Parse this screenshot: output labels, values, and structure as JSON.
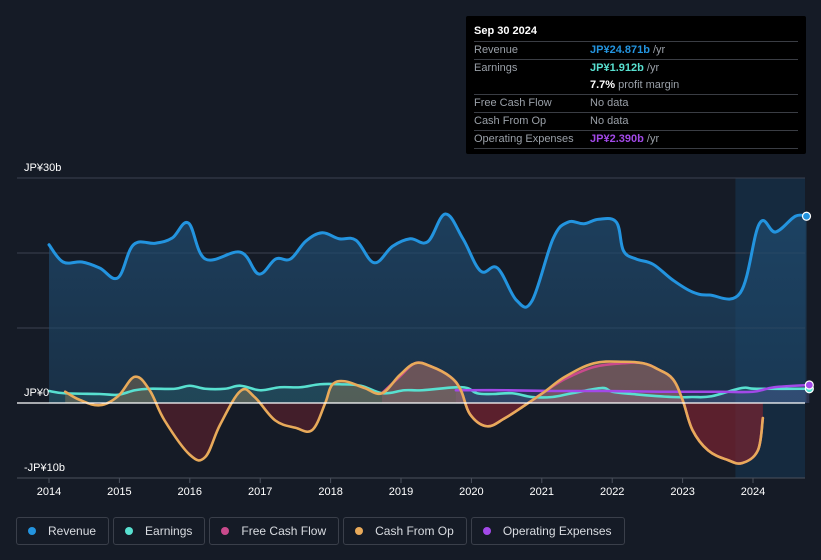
{
  "colors": {
    "background": "#151b26",
    "revenue": "#2394df",
    "earnings": "#58e0d0",
    "free_cash_flow": "#c94a8c",
    "cash_from_op": "#e8aa5a",
    "operating_expenses": "#a249e8",
    "grid": "#3a4150",
    "zero_line": "#ffffff",
    "negative_fill": "#5a1f26",
    "highlight_band": "#1a3550"
  },
  "tooltip": {
    "date": "Sep 30 2024",
    "rows": [
      {
        "label": "Revenue",
        "value": "JP¥24.871b",
        "suffix": " /yr",
        "color": "#2394df"
      },
      {
        "label": "Earnings",
        "value": "JP¥1.912b",
        "suffix": " /yr",
        "color": "#58e0d0"
      },
      {
        "label": "",
        "value": "7.7%",
        "suffix": " profit margin",
        "color": "#ffffff"
      },
      {
        "label": "Free Cash Flow",
        "value": "",
        "suffix": "No data",
        "color": "#9aa0a8"
      },
      {
        "label": "Cash From Op",
        "value": "",
        "suffix": "No data",
        "color": "#9aa0a8"
      },
      {
        "label": "Operating Expenses",
        "value": "JP¥2.390b",
        "suffix": " /yr",
        "color": "#a249e8"
      }
    ]
  },
  "legend": [
    {
      "label": "Revenue",
      "key": "revenue"
    },
    {
      "label": "Earnings",
      "key": "earnings"
    },
    {
      "label": "Free Cash Flow",
      "key": "free_cash_flow"
    },
    {
      "label": "Cash From Op",
      "key": "cash_from_op"
    },
    {
      "label": "Operating Expenses",
      "key": "operating_expenses"
    }
  ],
  "chart_data": {
    "type": "area",
    "title": "",
    "xlabel": "",
    "ylabel": "",
    "y_tick_labels": [
      {
        "value": 30,
        "label": "JP¥30b"
      },
      {
        "value": 0,
        "label": "JP¥0"
      },
      {
        "value": -10,
        "label": "-JP¥10b"
      }
    ],
    "x_tick_labels": [
      "2014",
      "2015",
      "2016",
      "2017",
      "2018",
      "2019",
      "2020",
      "2021",
      "2022",
      "2023",
      "2024"
    ],
    "xlim": [
      2013.55,
      2024.8
    ],
    "ylim": [
      -10,
      30
    ],
    "grid": true,
    "highlight_from": 2023.75,
    "legend_position": "bottom-left",
    "units": "JPY billions",
    "series": [
      {
        "name": "Revenue",
        "key": "revenue",
        "x": [
          2014.0,
          2014.2,
          2014.47,
          2014.72,
          2014.98,
          2015.2,
          2015.51,
          2015.75,
          2015.98,
          2016.22,
          2016.72,
          2016.98,
          2017.22,
          2017.43,
          2017.65,
          2017.88,
          2018.12,
          2018.36,
          2018.62,
          2018.88,
          2019.13,
          2019.38,
          2019.63,
          2019.88,
          2020.13,
          2020.37,
          2020.64,
          2020.86,
          2021.16,
          2021.37,
          2021.6,
          2021.81,
          2022.06,
          2022.16,
          2022.34,
          2022.58,
          2022.86,
          2023.14,
          2023.38,
          2023.82,
          2024.09,
          2024.32,
          2024.6,
          2024.76
        ],
        "values": [
          21.1,
          18.8,
          18.8,
          18.0,
          16.7,
          21.1,
          21.3,
          22.0,
          24.0,
          19.2,
          20.1,
          17.2,
          19.2,
          19.2,
          21.6,
          22.7,
          21.9,
          21.7,
          18.7,
          20.9,
          21.9,
          21.5,
          25.2,
          21.9,
          17.6,
          18.0,
          13.7,
          13.6,
          21.9,
          24.1,
          23.9,
          24.5,
          24.1,
          20.3,
          19.2,
          18.5,
          16.4,
          14.8,
          14.4,
          14.7,
          23.9,
          22.8,
          24.9,
          24.9
        ]
      },
      {
        "name": "Earnings",
        "key": "earnings",
        "x": [
          2014.0,
          2014.22,
          2014.72,
          2014.98,
          2015.22,
          2015.43,
          2015.79,
          2016.0,
          2016.22,
          2016.5,
          2016.72,
          2017.0,
          2017.28,
          2017.57,
          2017.85,
          2018.13,
          2018.43,
          2018.74,
          2019.05,
          2019.3,
          2019.87,
          2020.08,
          2020.3,
          2020.58,
          2020.86,
          2021.15,
          2021.43,
          2021.85,
          2022.0,
          2022.28,
          2022.85,
          2023.13,
          2023.41,
          2023.84,
          2024.05,
          2024.8
        ],
        "values": [
          1.6,
          1.3,
          1.2,
          1.1,
          1.7,
          1.9,
          1.9,
          2.3,
          1.9,
          1.9,
          2.3,
          1.7,
          2.1,
          2.1,
          2.5,
          2.5,
          2.3,
          1.3,
          1.7,
          1.7,
          2.1,
          1.3,
          1.2,
          1.3,
          0.8,
          0.8,
          1.3,
          2.0,
          1.5,
          1.2,
          0.8,
          0.8,
          0.9,
          2.0,
          1.9,
          1.9
        ]
      },
      {
        "name": "Free Cash Flow",
        "key": "free_cash_flow",
        "x": [
          2018.73,
          2018.98,
          2019.2,
          2019.42,
          2019.7,
          2019.85,
          2019.98,
          2020.22,
          2020.48,
          2020.76,
          2021.04,
          2021.33,
          2021.74,
          2022.16,
          2022.44,
          2022.65,
          2022.86,
          2023.0,
          2023.14,
          2023.36,
          2023.64,
          2023.85,
          2024.07,
          2024.14
        ],
        "values": [
          1.3,
          3.5,
          5.3,
          4.9,
          3.5,
          1.7,
          -1.5,
          -3.1,
          -2.0,
          -0.3,
          1.5,
          3.2,
          4.8,
          5.3,
          5.3,
          4.5,
          3.2,
          0.4,
          -3.6,
          -6.3,
          -7.6,
          -8.0,
          -6.3,
          -2.0
        ]
      },
      {
        "name": "Cash From Op",
        "key": "cash_from_op",
        "x": [
          2014.23,
          2014.44,
          2014.72,
          2014.98,
          2015.22,
          2015.43,
          2015.64,
          2016.0,
          2016.22,
          2016.43,
          2016.72,
          2016.92,
          2017.21,
          2017.5,
          2017.74,
          2017.92,
          2018.02,
          2018.2,
          2018.48,
          2018.73,
          2018.98,
          2019.2,
          2019.42,
          2019.7,
          2019.85,
          2019.98,
          2020.22,
          2020.48,
          2020.76,
          2021.04,
          2021.33,
          2021.74,
          2022.16,
          2022.44,
          2022.65,
          2022.86,
          2023.0,
          2023.14,
          2023.36,
          2023.64,
          2023.85,
          2024.07,
          2024.14
        ],
        "values": [
          1.5,
          0.4,
          -0.3,
          0.9,
          3.5,
          1.7,
          -2.3,
          -6.9,
          -7.2,
          -2.9,
          1.6,
          0.8,
          -2.3,
          -3.3,
          -3.6,
          -0.1,
          2.4,
          2.9,
          2.0,
          1.3,
          3.7,
          5.3,
          4.9,
          3.5,
          1.7,
          -1.5,
          -3.1,
          -2.0,
          -0.3,
          1.5,
          3.5,
          5.3,
          5.5,
          5.3,
          4.5,
          3.2,
          0.4,
          -3.6,
          -6.3,
          -7.6,
          -8.0,
          -6.3,
          -2.0
        ]
      },
      {
        "name": "Operating Expenses",
        "key": "operating_expenses",
        "x": [
          2019.78,
          2020.5,
          2021.2,
          2021.9,
          2022.7,
          2023.5,
          2024.0,
          2024.3,
          2024.8
        ],
        "values": [
          1.7,
          1.7,
          1.6,
          1.6,
          1.5,
          1.5,
          1.5,
          2.1,
          2.4
        ]
      }
    ]
  }
}
